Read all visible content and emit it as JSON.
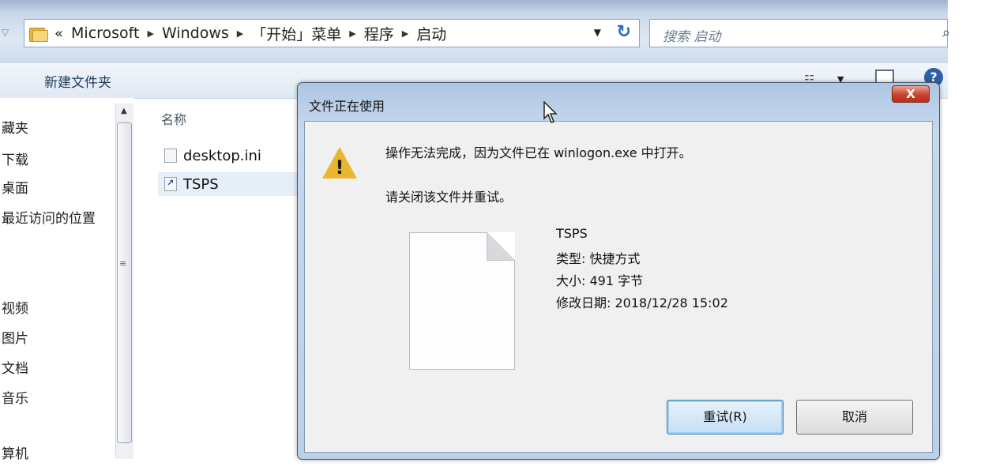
{
  "explorer": {
    "address": {
      "raquo": "«",
      "crumbs": [
        "Microsoft",
        "Windows",
        "「开始」菜单",
        "程序",
        "启动"
      ],
      "separator": "▶",
      "dropdown": "▼",
      "refresh": "↻"
    },
    "search": {
      "placeholder": "搜索 启动"
    },
    "toolbar": {
      "new_folder": "新建文件夹"
    },
    "nav": {
      "items": [
        "藏夹",
        "下载",
        "桌面",
        "最近访问的位置",
        "视频",
        "图片",
        "文档",
        "音乐",
        "算机"
      ]
    },
    "files": {
      "column_name": "名称",
      "items": [
        {
          "name": "desktop.ini",
          "icon": "ini-file-icon"
        },
        {
          "name": "TSPS",
          "icon": "shortcut-icon"
        }
      ]
    }
  },
  "dialog": {
    "title": "文件正在使用",
    "close_label": "X",
    "message": "操作无法完成，因为文件已在 winlogon.exe 中打开。",
    "retry_prompt": "请关闭该文件并重试。",
    "file": {
      "name": "TSPS",
      "type": "类型: 快捷方式",
      "size": "大小: 491 字节",
      "modified": "修改日期: 2018/12/28 15:02"
    },
    "buttons": {
      "retry": "重试(R)",
      "cancel": "取消"
    },
    "warning_mark": "!"
  },
  "colors": {
    "dialog_frame": "#c6d8ee",
    "close_button": "#c8432d",
    "warning": "#e9b72f",
    "primary_button_border": "#3c7fb1"
  }
}
